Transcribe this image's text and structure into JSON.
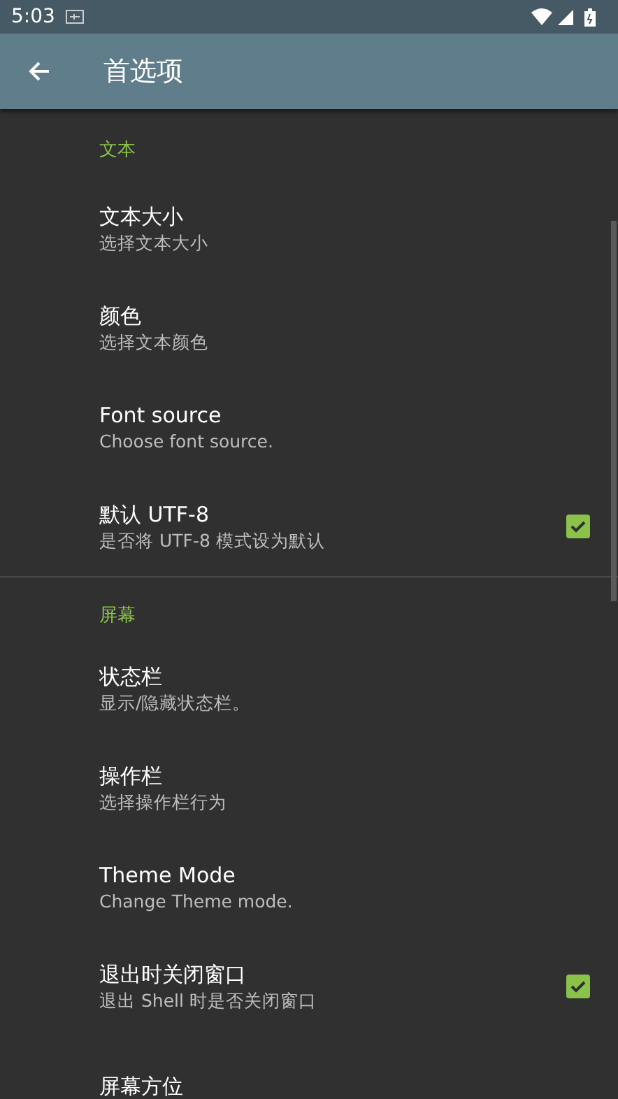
{
  "status_bar": {
    "time": "5:03"
  },
  "toolbar": {
    "title": "首选项"
  },
  "sections": [
    {
      "header": "文本",
      "items": [
        {
          "kind": "plain",
          "title": "文本大小",
          "summary": "选择文本大小"
        },
        {
          "kind": "plain",
          "title": "颜色",
          "summary": "选择文本颜色"
        },
        {
          "kind": "plain",
          "title": "Font source",
          "summary": "Choose font source."
        },
        {
          "kind": "checkbox",
          "title": "默认 UTF-8",
          "summary": "是否将 UTF-8 模式设为默认",
          "checked": true
        }
      ]
    },
    {
      "header": "屏幕",
      "items": [
        {
          "kind": "plain",
          "title": "状态栏",
          "summary": "显示/隐藏状态栏。"
        },
        {
          "kind": "plain",
          "title": "操作栏",
          "summary": "选择操作栏行为"
        },
        {
          "kind": "plain",
          "title": "Theme Mode",
          "summary": "Change Theme mode."
        },
        {
          "kind": "checkbox",
          "title": "退出时关闭窗口",
          "summary": "退出 Shell 时是否关闭窗口",
          "checked": true
        },
        {
          "kind": "plain",
          "title": "屏幕方位"
        }
      ]
    }
  ]
}
